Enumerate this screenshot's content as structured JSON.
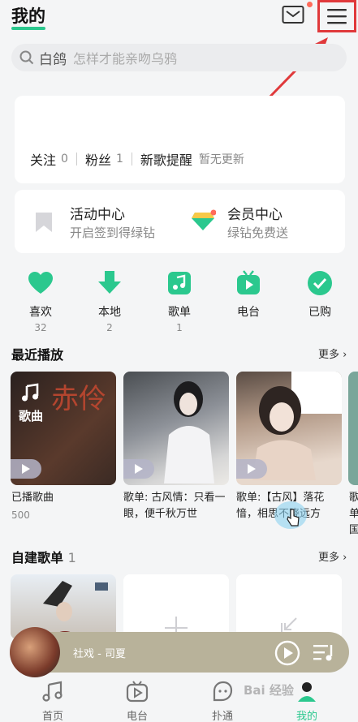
{
  "header": {
    "title": "我的"
  },
  "search": {
    "keyword": "白鸽",
    "placeholder": "怎样才能亲吻乌鸦"
  },
  "profile": {
    "following_label": "关注",
    "following_count": "0",
    "fans_label": "粉丝",
    "fans_count": "1",
    "new_song_label": "新歌提醒",
    "new_song_status": "暂无更新"
  },
  "activities": [
    {
      "title": "活动中心",
      "subtitle": "开启签到得绿钻"
    },
    {
      "title": "会员中心",
      "subtitle": "绿钻免费送"
    }
  ],
  "quick_items": [
    {
      "label": "喜欢",
      "count": "32",
      "icon": "heart-icon"
    },
    {
      "label": "本地",
      "count": "2",
      "icon": "download-icon"
    },
    {
      "label": "歌单",
      "count": "1",
      "icon": "music-note-icon"
    },
    {
      "label": "电台",
      "count": "",
      "icon": "radio-tv-icon"
    },
    {
      "label": "已购",
      "count": "",
      "icon": "check-icon"
    }
  ],
  "recent": {
    "title": "最近播放",
    "more": "更多",
    "items": [
      {
        "overlay": "歌曲",
        "caption": "已播歌曲",
        "count": "500"
      },
      {
        "caption": "歌单: 古风情：只看一眼，便千秋万世"
      },
      {
        "caption": "歌单:【古风】落花愔，相思不晓远方"
      },
      {
        "caption": "歌单国"
      }
    ]
  },
  "playlists": {
    "title": "自建歌单",
    "count": "1",
    "more": "更多"
  },
  "player": {
    "song": "社戏 - 司夏"
  },
  "tabs": [
    {
      "label": "首页",
      "icon": "music-note-icon"
    },
    {
      "label": "电台",
      "icon": "radio-tv-icon"
    },
    {
      "label": "扑通",
      "icon": "chat-face-icon"
    },
    {
      "label": "我的",
      "icon": "person-icon"
    }
  ],
  "colors": {
    "accent": "#2bc88e",
    "highlight_box": "#e0393b",
    "notification_dot": "#ff6b5a"
  }
}
